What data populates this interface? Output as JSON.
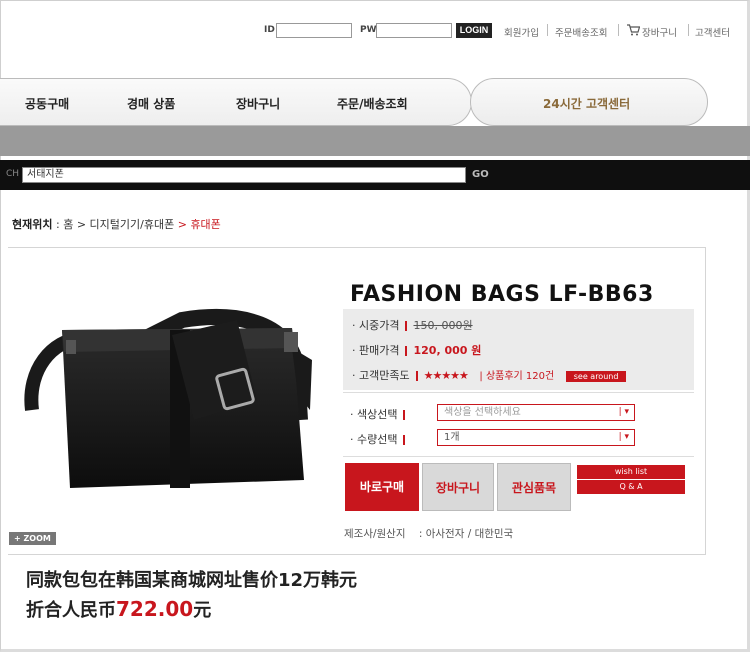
{
  "top_bar": {
    "id_label": "ID",
    "pw_label": "PW",
    "login_label": "LOGIN",
    "links": [
      "회원가입",
      "주문배송조회",
      "장바구니",
      "고객센터"
    ]
  },
  "nav": {
    "items": [
      "공동구매",
      "경매 상품",
      "장바구니",
      "주문/배송조회"
    ],
    "cs_label": "24시간 고객센터"
  },
  "search": {
    "left_label": "CH",
    "value": "서태지폰",
    "go_label": "GO"
  },
  "breadcrumb": {
    "label": "현재위치",
    "sep": ":",
    "home": "홈",
    "category": "디지털기기/휴대폰",
    "current": "휴대폰"
  },
  "product": {
    "title": "FASHION BAGS LF-BB63",
    "zoom_label": "+ ZOOM",
    "list_price_label": "· 시중가격",
    "list_price": "150, 000원",
    "sale_price_label": "· 판매가격",
    "sale_price": "120, 000 원",
    "rating_label": "· 고객만족도",
    "stars": "★★★★★",
    "review_text": "| 상품후기 120건",
    "see_around": "see around",
    "color_label": "· 색상선택",
    "color_placeholder": "색상을 선택하세요",
    "qty_label": "· 수량선택",
    "qty_value": "1개",
    "buy_now": "바로구매",
    "add_cart": "장바구니",
    "wishlist": "관심품목",
    "wish_list": "wish list",
    "qna": "Q & A",
    "maker_label": "제조사/원산지",
    "maker_value": ":  아사전자 / 대한민국"
  },
  "caption": {
    "line1": "同款包包在韩国某商城网址售价12万韩元",
    "line2_prefix": "折合人民币",
    "line2_amount": "722.00",
    "line2_suffix": "元"
  },
  "colors": {
    "accent": "#c8161d",
    "nav_grey": "#9a9a9a",
    "search_bar": "#0f0f0f"
  }
}
